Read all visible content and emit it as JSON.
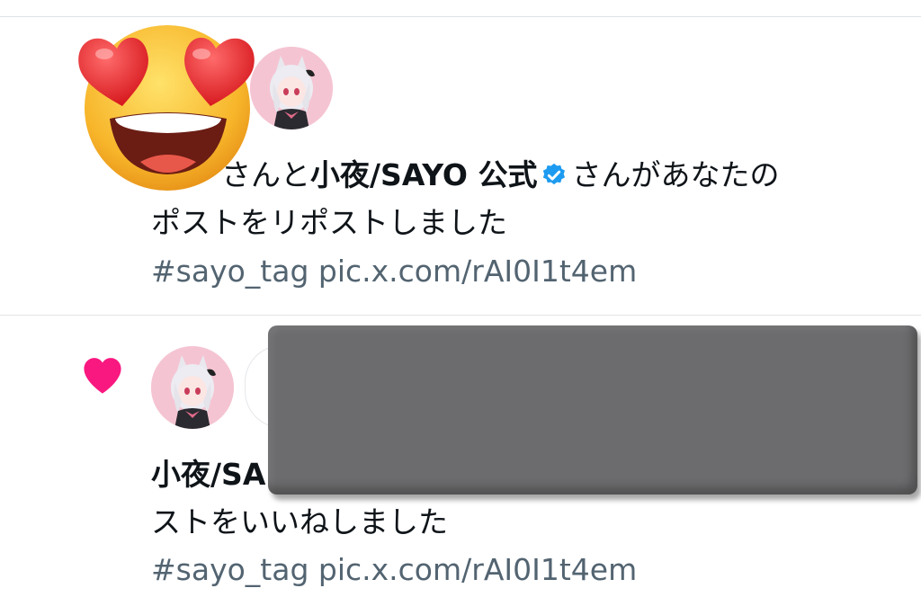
{
  "notifications": [
    {
      "actor_prefix": "さんと",
      "actor_name": "小夜/SAYO 公式",
      "action_line1": "さんがあなたの",
      "action_line2": "ポストをリポストしました",
      "meta": "#sayo_tag pic.x.com/rAI0I1t4em"
    },
    {
      "actor_name": "小夜/SA",
      "action_line2": "ストをいいねしました",
      "meta": "#sayo_tag pic.x.com/rAI0I1t4em"
    }
  ],
  "icons": {
    "heart_color": "#f91880",
    "verified_color": "#1d9bf0",
    "emoji": "heart-eyes-emoji"
  }
}
